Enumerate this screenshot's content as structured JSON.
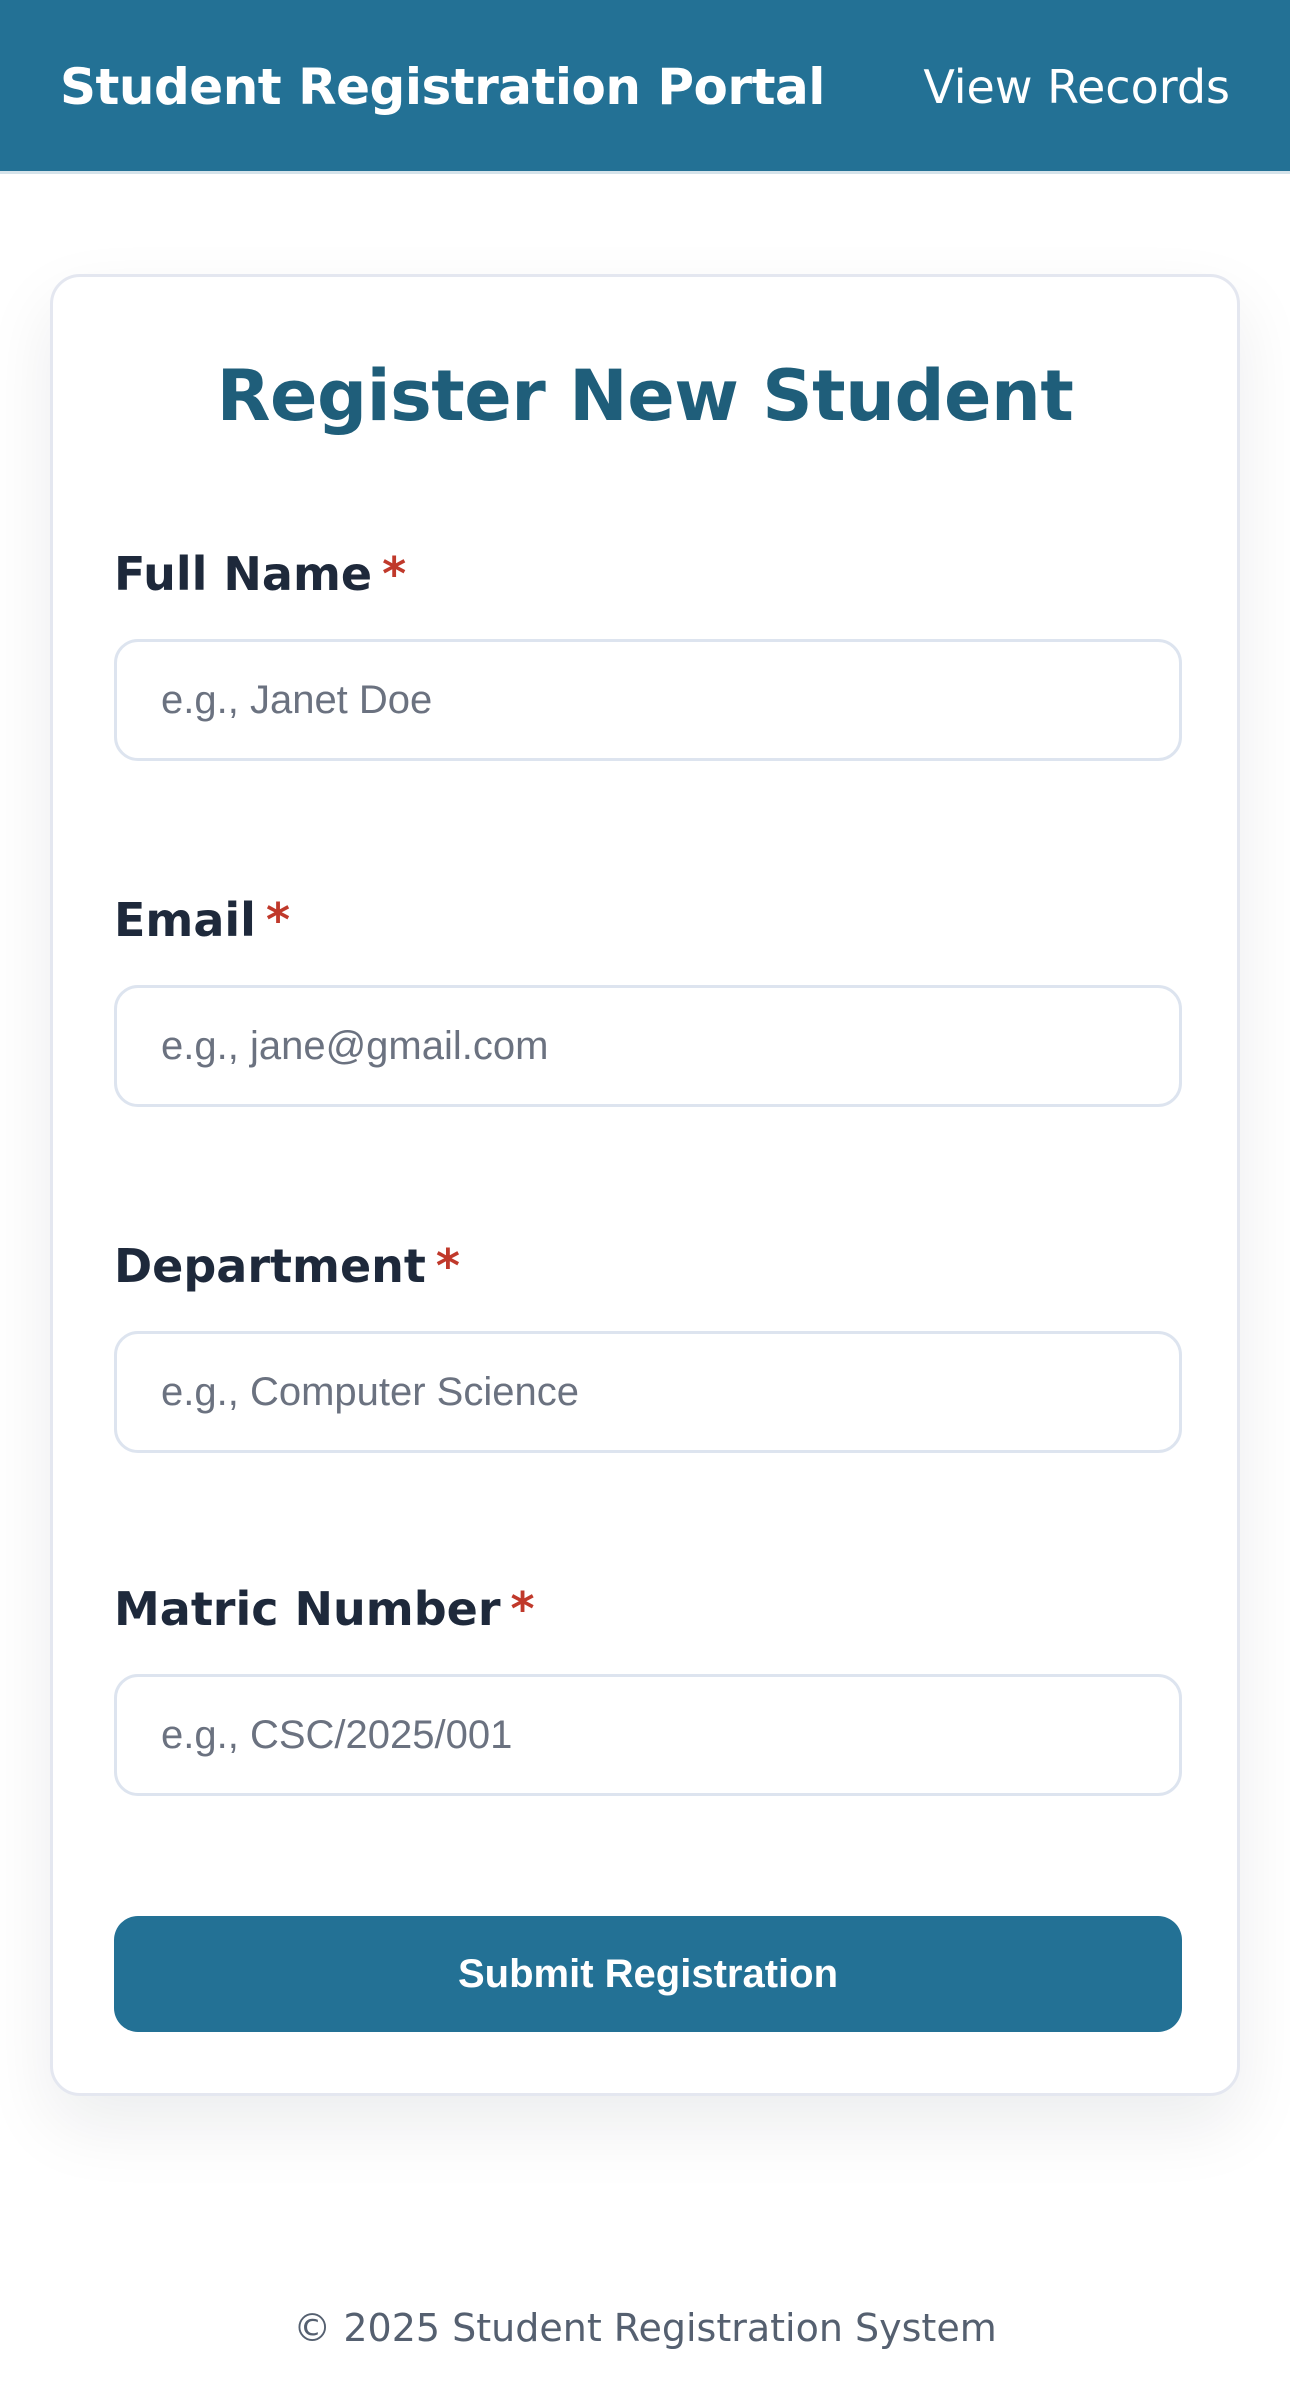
{
  "header": {
    "title": "Student Registration Portal",
    "nav_link": "View Records"
  },
  "form": {
    "title": "Register New Student",
    "required_marker": "*",
    "fields": [
      {
        "label": "Full Name",
        "placeholder": "e.g., Janet Doe",
        "value": ""
      },
      {
        "label": "Email",
        "placeholder": "e.g., jane@gmail.com",
        "value": ""
      },
      {
        "label": "Department",
        "placeholder": "e.g., Computer Science",
        "value": ""
      },
      {
        "label": "Matric Number",
        "placeholder": "e.g., CSC/2025/001",
        "value": ""
      }
    ],
    "submit_label": "Submit Registration"
  },
  "footer": {
    "text": "© 2025 Student Registration System"
  },
  "colors": {
    "brand": "#237195",
    "title": "#1f5e7a",
    "required": "#c0392b"
  }
}
